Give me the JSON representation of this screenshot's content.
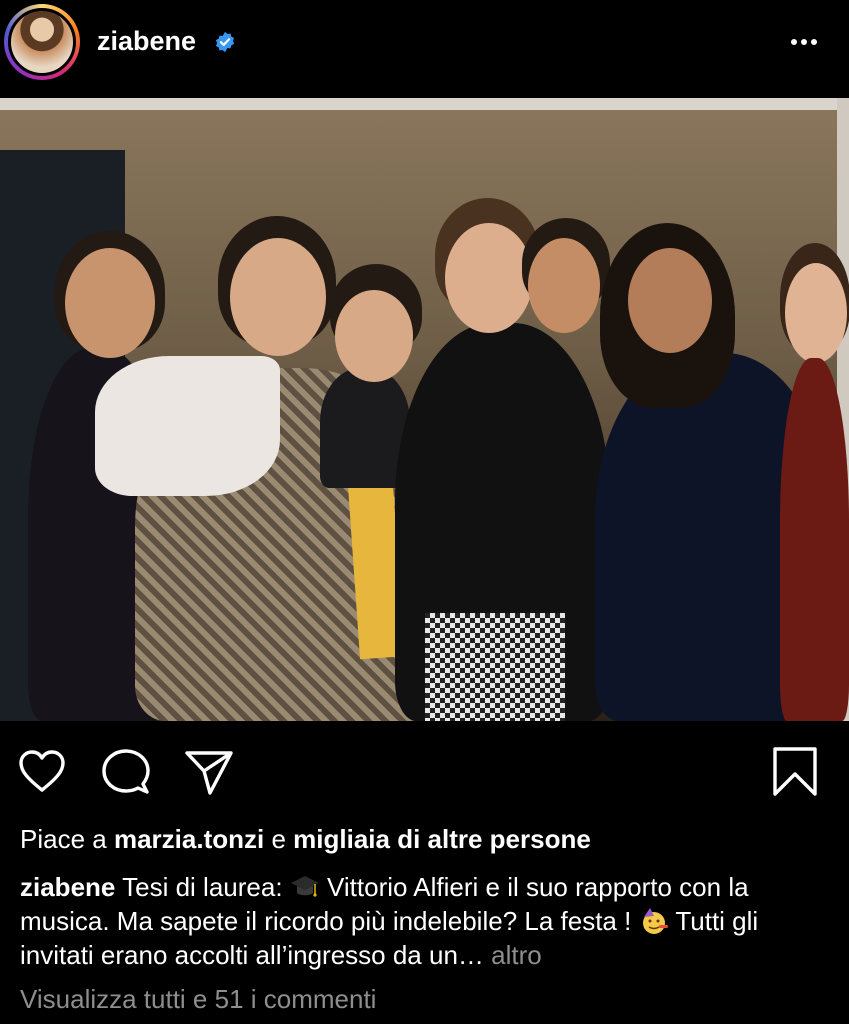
{
  "post": {
    "username": "ziabene",
    "verified": true,
    "more_icon": "more-horizontal-icon",
    "photo_alt": "Group photo"
  },
  "actions": {
    "like_icon": "heart-icon",
    "comment_icon": "comment-icon",
    "share_icon": "send-icon",
    "save_icon": "bookmark-icon"
  },
  "likes": {
    "prefix": "Piace a",
    "user": "marzia.tonzi",
    "connector": "e",
    "others": "migliaia di altre persone"
  },
  "caption": {
    "username": "ziabene",
    "text_1": "Tesi di laurea:",
    "text_2": "Vittorio Alfieri e il suo rapporto con la musica. Ma sapete il ricordo più indelebile? La festa !",
    "text_3": "Tutti gli invitati erano accolti all’ingresso da un…",
    "more_label": "altro",
    "emoji_1": "graduation-cap-emoji",
    "emoji_2": "party-face-emoji"
  },
  "comments": {
    "label": "Visualizza tutti e 51 i commenti"
  },
  "colors": {
    "background": "#000000",
    "text": "#ffffff",
    "muted": "#8e8e8e",
    "verified": "#3897f0"
  }
}
